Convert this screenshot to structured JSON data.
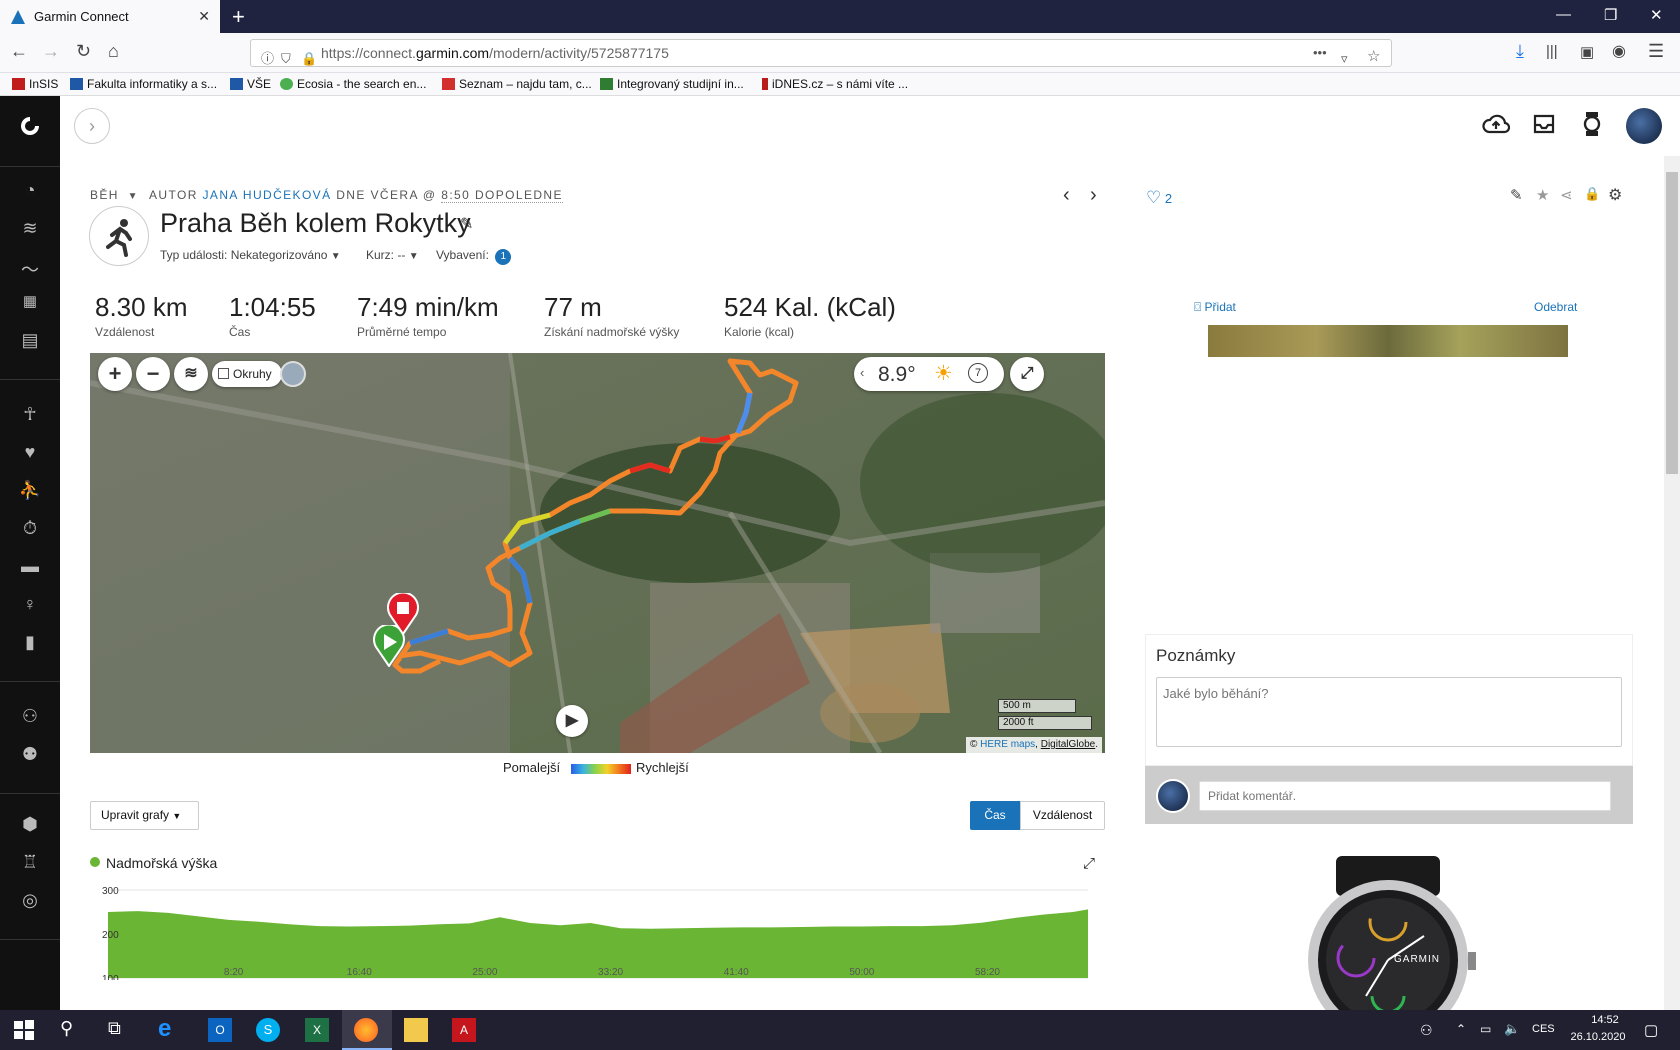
{
  "browser": {
    "tab_title": "Garmin Connect",
    "url_prefix": "https://connect.",
    "url_domain": "garmin.com",
    "url_path": "/modern/activity/5725877175",
    "bookmarks": [
      {
        "label": "InSIS",
        "color": "#c21d1d"
      },
      {
        "label": "Fakulta informatiky a s...",
        "color": "#1f58a5"
      },
      {
        "label": "VŠE",
        "color": "#1f58a5"
      },
      {
        "label": "Ecosia - the search en...",
        "color": "#4caf50"
      },
      {
        "label": "Seznam – najdu tam, c...",
        "color": "#d32f2f"
      },
      {
        "label": "Integrovaný studijní in...",
        "color": "#2e7d32"
      },
      {
        "label": "iDNES.cz – s námi víte ...",
        "color": "#b71c1c"
      }
    ]
  },
  "activity": {
    "type": "BĚH",
    "author_prefix": "AUTOR",
    "author": "JANA HUDČEKOVÁ",
    "date_prefix": "DNE VČERA @",
    "time": "8:50 DOPOLEDNE",
    "title": "Praha Běh kolem Rokytky",
    "event_type": "Typ události: Nekategorizováno",
    "course": "Kurz: --",
    "gear": "Vybavení:",
    "gear_count": "1",
    "likes": "2"
  },
  "stats": [
    {
      "value": "8.30 km",
      "label": "Vzdálenost"
    },
    {
      "value": "1:04:55",
      "label": "Čas"
    },
    {
      "value": "7:49 min/km",
      "label": "Průměrné tempo"
    },
    {
      "value": "77 m",
      "label": "Získání nadmořské výšky"
    },
    {
      "value": "524 Kal. (kCal)",
      "label": "Kalorie (kcal)"
    }
  ],
  "map": {
    "laps_label": "Okruhy",
    "temperature": "8.9°",
    "weather_count": "7",
    "scale_m": "500 m",
    "scale_ft": "2000 ft",
    "attribution_prefix": "© ",
    "attribution_here": "HERE maps",
    "attribution_dg": "DigitalGlobe",
    "legend_slow": "Pomalejší",
    "legend_fast": "Rychlejší"
  },
  "charts_controls": {
    "edit_label": "Upravit grafy",
    "toggle_time": "Čas",
    "toggle_distance": "Vzdálenost"
  },
  "photo_panel": {
    "add_label": "Přidat",
    "remove_label": "Odebrat"
  },
  "notes": {
    "title": "Poznámky",
    "placeholder": "Jaké bylo běhání?",
    "comment_placeholder": "Přidat komentář."
  },
  "device_brand": "GARMIN",
  "chart_data": {
    "type": "area",
    "title": "Nadmořská výška",
    "xlabel": "",
    "ylabel": "",
    "ylim": [
      100,
      300
    ],
    "yticks": [
      "300",
      "200",
      "100"
    ],
    "xticks": [
      "8:20",
      "16:40",
      "25:00",
      "33:20",
      "41:40",
      "50:00",
      "58:20"
    ],
    "x": [
      0,
      2,
      4,
      6,
      8,
      10,
      12,
      14,
      16,
      18,
      20,
      22,
      24,
      26,
      28,
      30,
      32,
      34,
      36,
      38,
      40,
      42,
      44,
      46,
      48,
      50,
      52,
      54,
      56,
      58,
      60,
      62,
      64,
      65
    ],
    "values": [
      250,
      252,
      248,
      240,
      232,
      228,
      222,
      218,
      217,
      218,
      219,
      222,
      224,
      238,
      225,
      220,
      225,
      213,
      212,
      213,
      214,
      215,
      215,
      216,
      217,
      217,
      218,
      218,
      220,
      226,
      236,
      244,
      250,
      256
    ],
    "color": "#6ab534"
  },
  "taskbar": {
    "lang": "CES",
    "time": "14:52",
    "date": "26.10.2020"
  },
  "colors": {
    "sidebar": "#111111",
    "accent_blue": "#1a73b8",
    "toggle_active": "#1a73b8",
    "elevation_green": "#6ab534"
  }
}
